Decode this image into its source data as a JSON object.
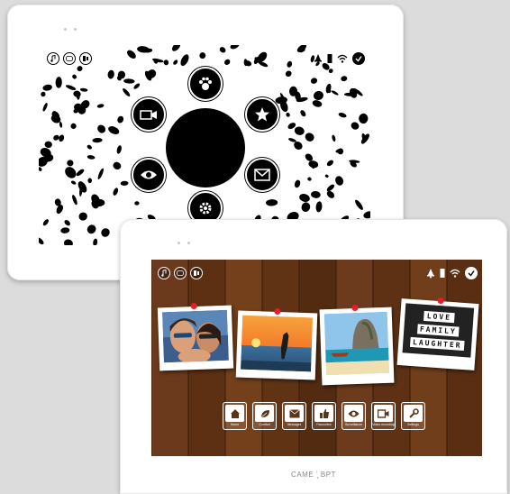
{
  "brand": "CAME ʼ̧ BPT",
  "back_device": {
    "top_left_icons": [
      "music-icon",
      "off-icon",
      "intercom-icon"
    ],
    "top_right_icons": [
      "bell-icon",
      "battery-icon",
      "wifi-icon",
      "check-icon"
    ],
    "menu_items": [
      "pet-icon",
      "star-icon",
      "message-icon",
      "settings-icon",
      "eye-icon",
      "camera-icon"
    ]
  },
  "front_device": {
    "top_left_icons": [
      "music-icon",
      "off-icon",
      "intercom-icon"
    ],
    "top_right_icons": [
      "bell-icon",
      "battery-icon",
      "wifi-icon",
      "check-icon"
    ],
    "lightbox_words": [
      "LOVE",
      "FAMILY",
      "LAUGHTER"
    ],
    "dock": [
      {
        "label": "Home",
        "icon": "home-icon"
      },
      {
        "label": "Comfort",
        "icon": "leaf-icon"
      },
      {
        "label": "Messages",
        "icon": "envelope-icon"
      },
      {
        "label": "Favourites",
        "icon": "thumbs-up-icon"
      },
      {
        "label": "Surveillance",
        "icon": "eye-icon"
      },
      {
        "label": "Video recording",
        "icon": "video-icon"
      },
      {
        "label": "Settings",
        "icon": "wrench-icon"
      }
    ]
  },
  "colors": {
    "pin": "#e21f2b",
    "wood": "#6e3a18",
    "accent": "#000000"
  }
}
